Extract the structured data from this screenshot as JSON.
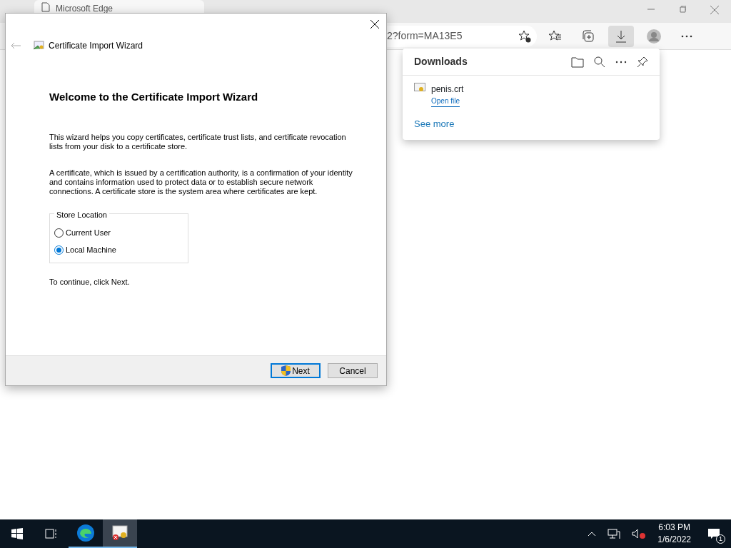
{
  "browser": {
    "tab": {
      "title": "Microsoft Edge"
    },
    "address": "2?form=MA13E5"
  },
  "downloads": {
    "title": "Downloads",
    "items": [
      {
        "name": "penis.crt",
        "action": "Open file"
      }
    ],
    "see_more": "See more"
  },
  "dialog": {
    "title": "Certificate Import Wizard",
    "heading": "Welcome to the Certificate Import Wizard",
    "paragraphs": [
      "This wizard helps you copy certificates, certificate trust lists, and certificate revocation lists from your disk to a certificate store.",
      "A certificate, which is issued by a certification authority, is a confirmation of your identity and contains information used to protect data or to establish secure network connections. A certificate store is the system area where certificates are kept."
    ],
    "group": {
      "label": "Store Location",
      "options": [
        {
          "label": "Current User",
          "selected": false
        },
        {
          "label": "Local Machine",
          "selected": true
        }
      ]
    },
    "footer_text": "To continue, click Next.",
    "buttons": [
      {
        "label": "Next",
        "kind": "shield",
        "focused": true
      },
      {
        "label": "Cancel",
        "kind": "plain",
        "focused": false
      }
    ]
  },
  "taskbar": {
    "apps": [
      {
        "kind": "edge",
        "active": false
      },
      {
        "kind": "certificate",
        "active": true
      }
    ],
    "time": "6:03 PM",
    "date": "1/6/2022",
    "notifications": "1"
  }
}
